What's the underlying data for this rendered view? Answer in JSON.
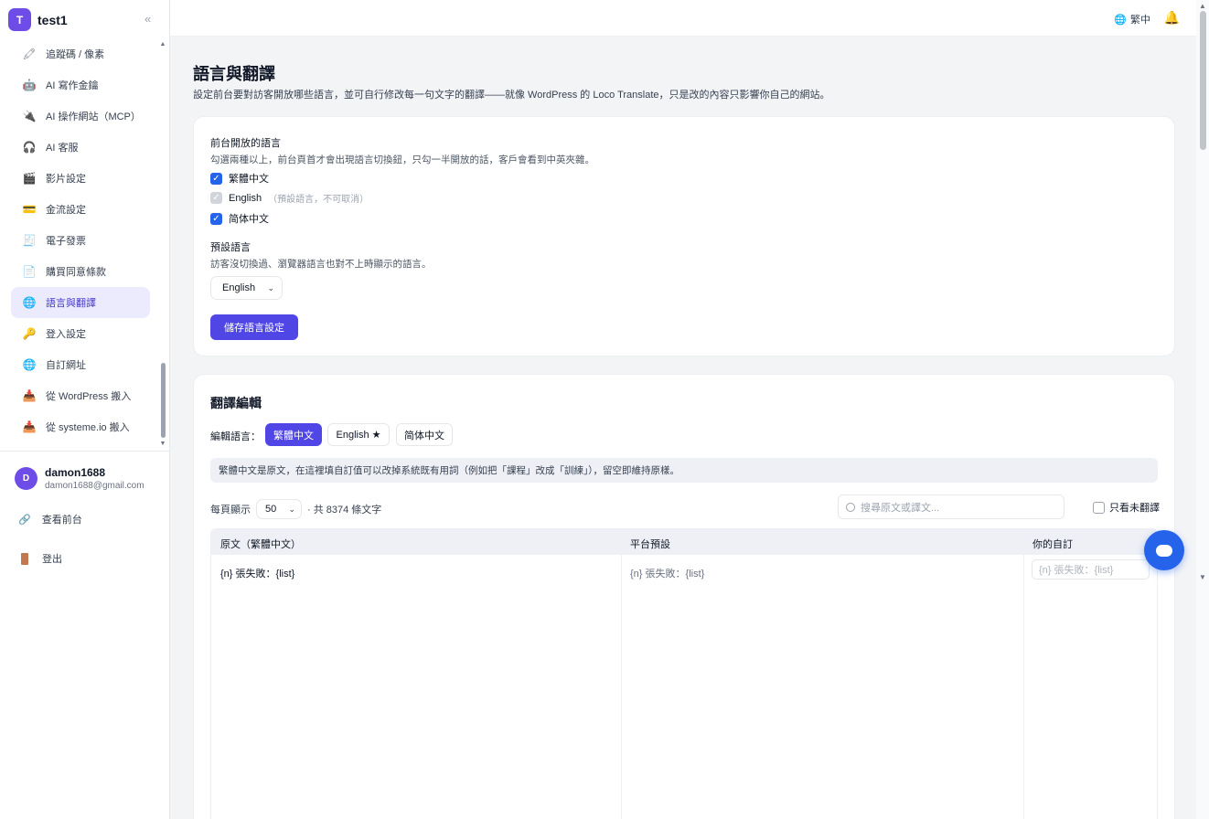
{
  "brand": {
    "initial": "T",
    "name": "test1",
    "collapse_icon": "«"
  },
  "sidebar": {
    "items": [
      {
        "label": "追蹤碼 / 像素",
        "icon": "🖍"
      },
      {
        "label": "AI 寫作金鑰",
        "icon": "🤖"
      },
      {
        "label": "AI 操作網站（MCP）",
        "icon": "🔌"
      },
      {
        "label": "AI 客服",
        "icon": "🎧"
      },
      {
        "label": "影片設定",
        "icon": "🎬"
      },
      {
        "label": "金流設定",
        "icon": "💳"
      },
      {
        "label": "電子發票",
        "icon": "🧾"
      },
      {
        "label": "購買同意條款",
        "icon": "📄"
      },
      {
        "label": "語言與翻譯",
        "icon": "🌐",
        "active": true
      },
      {
        "label": "登入設定",
        "icon": "🔑"
      },
      {
        "label": "自訂網址",
        "icon": "🌐"
      },
      {
        "label": "從 WordPress 搬入",
        "icon": "📥"
      },
      {
        "label": "從 systeme.io 搬入",
        "icon": "📥"
      }
    ],
    "user": {
      "initial": "D",
      "name": "damon1688",
      "email": "damon1688@gmail.com"
    },
    "view_frontend": "查看前台",
    "logout": "登出"
  },
  "topbar": {
    "language_label": "繁中"
  },
  "page": {
    "title": "語言與翻譯",
    "description": "設定前台要對訪客開放哪些語言，並可自行修改每一句文字的翻譯——就像 WordPress 的 Loco Translate，只是改的內容只影響你自己的網站。"
  },
  "languages_card": {
    "open_title": "前台開放的語言",
    "open_hint": "勾選兩種以上，前台頁首才會出現語言切換鈕，只勾一半開放的話，客戶會看到中英夾雜。",
    "options": [
      {
        "label": "繁體中文",
        "note": "",
        "state": "checked"
      },
      {
        "label": "English",
        "note": "（預設語言，不可取消）",
        "state": "disabled"
      },
      {
        "label": "简体中文",
        "note": "",
        "state": "checked"
      }
    ],
    "default_title": "預設語言",
    "default_hint": "訪客沒切換過、瀏覽器語言也對不上時顯示的語言。",
    "default_value": "English",
    "save_button": "儲存語言設定"
  },
  "translation_card": {
    "title": "翻譯編輯",
    "edit_language_label": "編輯語言：",
    "tabs": [
      {
        "label": "繁體中文",
        "active": true
      },
      {
        "label": "English ★",
        "active": false
      },
      {
        "label": "简体中文",
        "active": false
      }
    ],
    "info": "繁體中文是原文，在這裡填自訂值可以改掉系統既有用詞（例如把「課程」改成「訓練」），留空即維持原樣。",
    "per_page_label": "每頁顯示",
    "per_page_value": "50",
    "total_text": "· 共 8374 條文字",
    "search_placeholder": "搜尋原文或譯文...",
    "untranslated_label": "只看未翻譯",
    "columns": [
      "原文（繁體中文）",
      "平台預設",
      "你的自訂"
    ],
    "rows": [
      {
        "source": "{n} 張失敗：{list}",
        "default": "{n} 張失敗：{list}",
        "custom_placeholder": "{n} 張失敗：{list}"
      }
    ]
  },
  "colors": {
    "accent": "#4f46e5",
    "brand": "#6d4ce8",
    "fab": "#2563eb"
  }
}
